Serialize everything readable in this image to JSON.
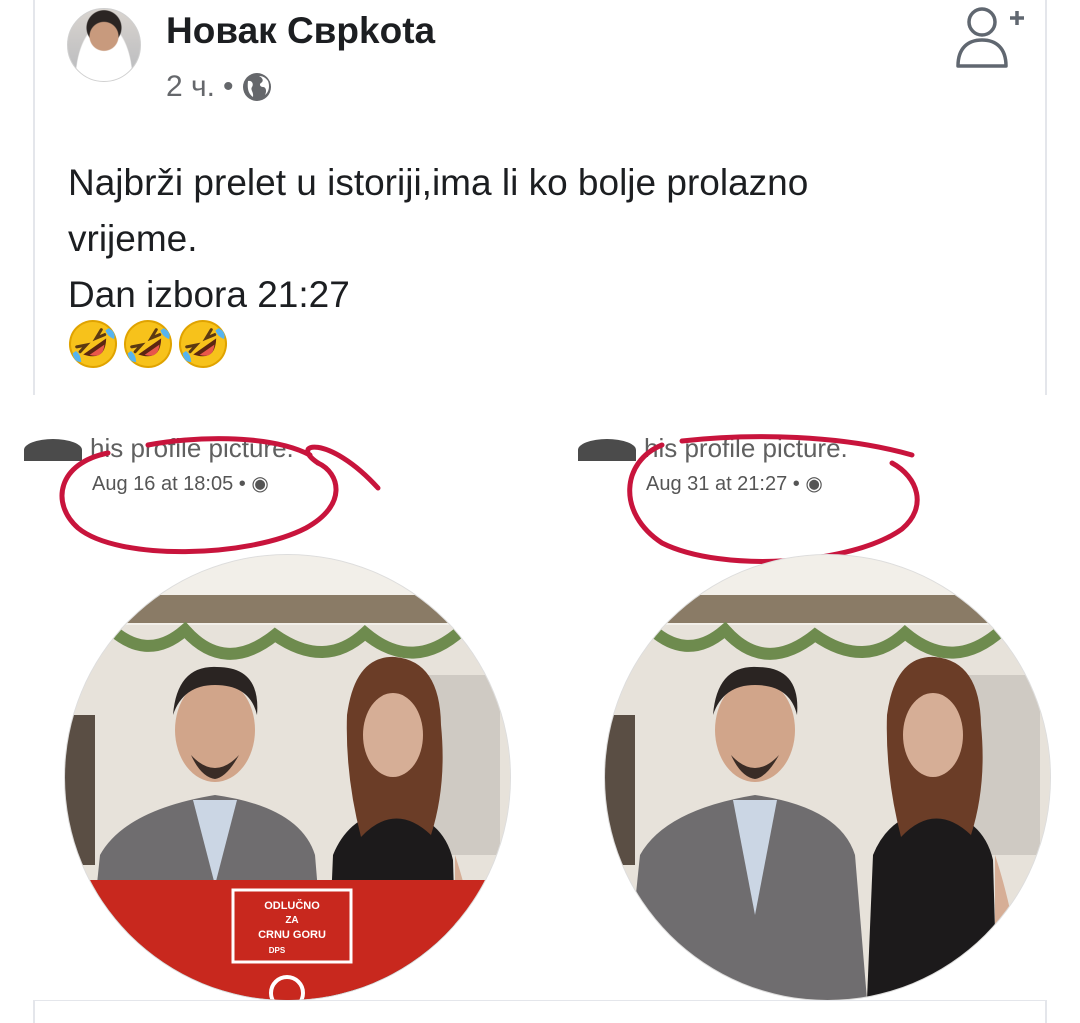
{
  "post": {
    "author": "Новак Сврkota",
    "time": "2 ч.",
    "separator": "•",
    "text_lines": [
      "Najbrži prelet u istoriji,ima li ko bolje prolazno",
      "vrijeme.",
      "Dan izbora 21:27"
    ],
    "emojis": [
      "rolling-on-floor-laughing-emoji",
      "rolling-on-floor-laughing-emoji",
      "rolling-on-floor-laughing-emoji"
    ],
    "icons": {
      "privacy": "globe-icon",
      "action": "add-friend-icon"
    }
  },
  "shared_image": {
    "left": {
      "profile_line": "his profile picture.",
      "timestamp": "Aug 16 at 18:05 • ◉",
      "banner": [
        "ODLUČNO",
        "ZA",
        "CRNU GORU",
        "DPS"
      ]
    },
    "right": {
      "profile_line": "his profile picture.",
      "timestamp": "Aug 31 at 21:27 • ◉"
    },
    "annotation_color": "#c8143c"
  },
  "colors": {
    "text": "#1c1e21",
    "meta": "#65676b",
    "banner_red": "#c8281e"
  }
}
